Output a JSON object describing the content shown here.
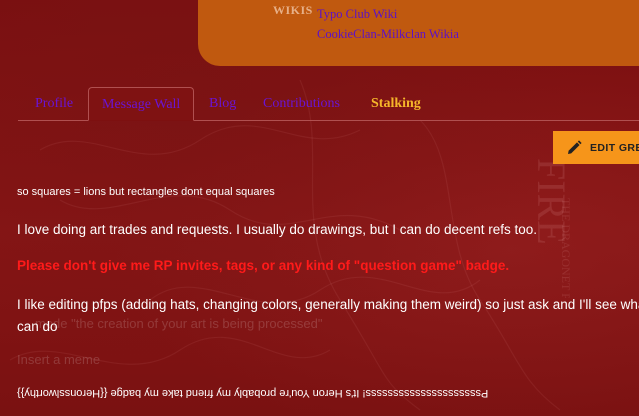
{
  "header": {
    "wikis_label": "WIKIS",
    "wiki_links": [
      "Typo Club Wiki",
      "CookieClan-Milkclan Wikia"
    ]
  },
  "tabs": [
    {
      "label": "Profile"
    },
    {
      "label": "Message Wall"
    },
    {
      "label": "Blog"
    },
    {
      "label": "Contributions"
    },
    {
      "label": "Stalking"
    }
  ],
  "edit_button": {
    "label": "EDIT GRE"
  },
  "profile_text": {
    "line_small": "so squares = lions but rectangles dont equal squares",
    "para1": "I love doing art trades and requests. I usually do drawings, but I can do decent refs too.",
    "para_red": "Please don't give me RP invites, tags, or any kind of \"question game\" badge.",
    "para3": "I like editing pfps (adding hats, changing colors, generally making them weird) so just ask and I'll see what I can do",
    "faded1": "mode \"the creation of your art is being processed\"",
    "faded2": "Insert a meme",
    "upside_down": "Psssssssssssssssssssss! It's Heron You're probably my friend take my badge {{Heronsslworthy}}"
  },
  "colors": {
    "background": "#7d1010",
    "header_card": "#c0590f",
    "link": "#6a14d4",
    "stalking": "#f5b62a",
    "warning": "#ff1a1a",
    "edit_button": "#f6951a"
  }
}
